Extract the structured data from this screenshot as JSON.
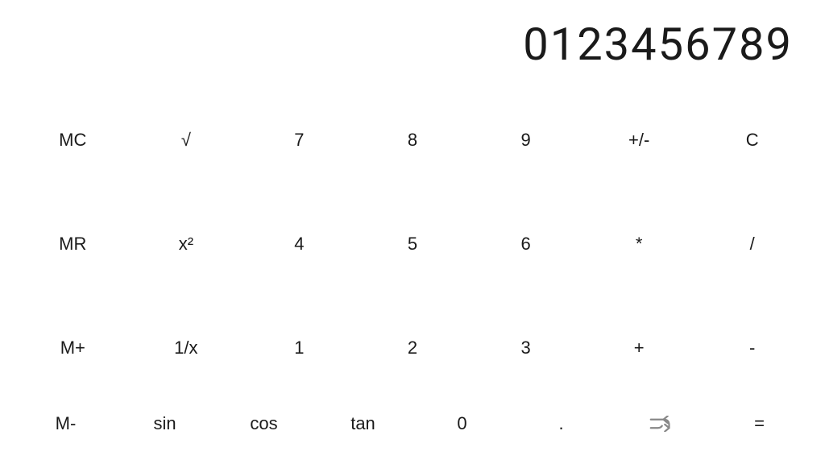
{
  "display": {
    "value": "0123456789"
  },
  "buttons": [
    [
      {
        "label": "MC",
        "name": "mc-button"
      },
      {
        "label": "√",
        "name": "sqrt-button"
      },
      {
        "label": "7",
        "name": "seven-button"
      },
      {
        "label": "8",
        "name": "eight-button"
      },
      {
        "label": "9",
        "name": "nine-button"
      },
      {
        "label": "+/-",
        "name": "plusminus-button"
      },
      {
        "label": "C",
        "name": "clear-button"
      }
    ],
    [
      {
        "label": "MR",
        "name": "mr-button"
      },
      {
        "label": "x²",
        "name": "square-button"
      },
      {
        "label": "4",
        "name": "four-button"
      },
      {
        "label": "5",
        "name": "five-button"
      },
      {
        "label": "6",
        "name": "six-button"
      },
      {
        "label": "*",
        "name": "multiply-button"
      },
      {
        "label": "/",
        "name": "divide-button"
      }
    ],
    [
      {
        "label": "M+",
        "name": "mplus-button"
      },
      {
        "label": "1/x",
        "name": "reciprocal-button"
      },
      {
        "label": "1",
        "name": "one-button"
      },
      {
        "label": "2",
        "name": "two-button"
      },
      {
        "label": "3",
        "name": "three-button"
      },
      {
        "label": "+",
        "name": "add-button"
      },
      {
        "label": "-",
        "name": "subtract-button"
      }
    ],
    [
      {
        "label": "M-",
        "name": "mminus-button"
      },
      {
        "label": "sin",
        "name": "sin-button"
      },
      {
        "label": "cos",
        "name": "cos-button"
      },
      {
        "label": "tan",
        "name": "tan-button"
      },
      {
        "label": "0",
        "name": "zero-button"
      },
      {
        "label": ".",
        "name": "decimal-button"
      },
      {
        "label": "SHUFFLE",
        "name": "shuffle-button"
      },
      {
        "label": "=",
        "name": "equals-button"
      }
    ]
  ]
}
